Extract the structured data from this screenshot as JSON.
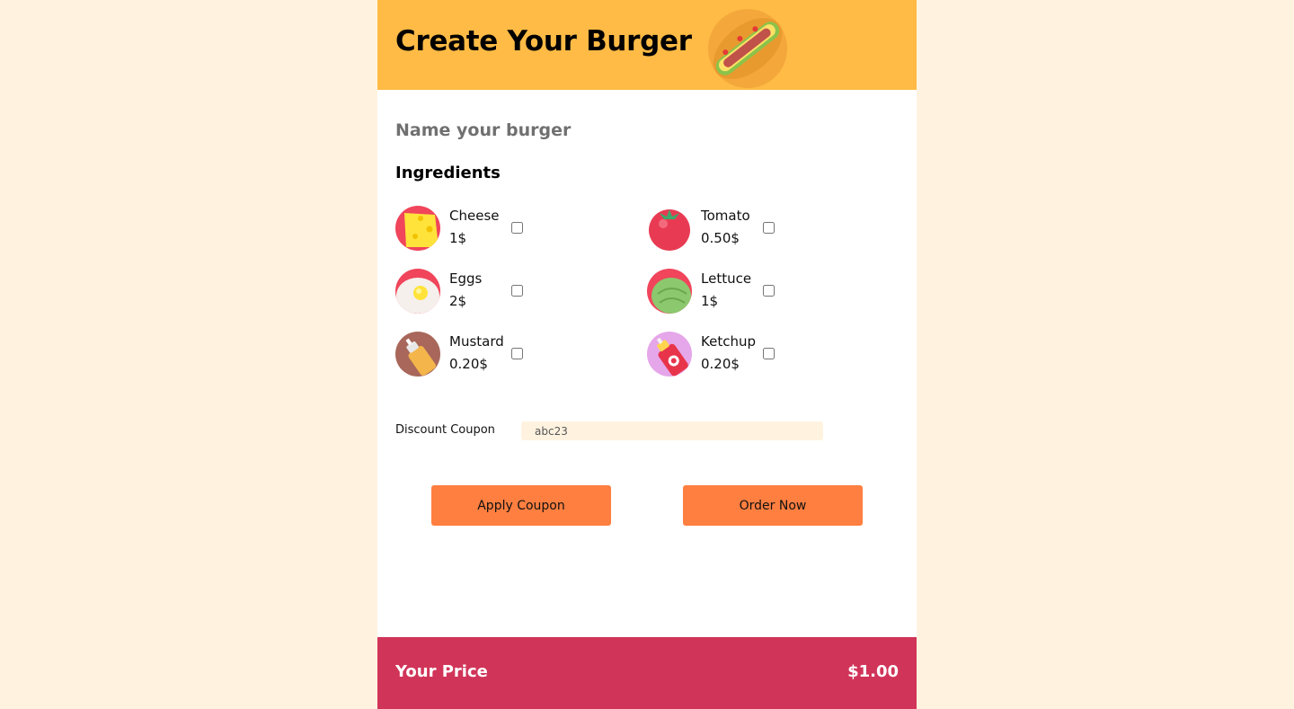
{
  "header": {
    "title": "Create Your Burger",
    "logo_icon": "burger-icon"
  },
  "name_field": {
    "placeholder": "Name your burger",
    "value": ""
  },
  "ingredients_section": {
    "title": "Ingredients"
  },
  "ingredients": [
    {
      "name": "Cheese",
      "price": "1$",
      "icon": "cheese-icon",
      "checked": false,
      "bg": "#f0455b"
    },
    {
      "name": "Tomato",
      "price": "0.50$",
      "icon": "tomato-icon",
      "checked": false,
      "bg": "#f0455b"
    },
    {
      "name": "Eggs",
      "price": "2$",
      "icon": "egg-icon",
      "checked": false,
      "bg": "#f0455b"
    },
    {
      "name": "Lettuce",
      "price": "1$",
      "icon": "lettuce-icon",
      "checked": false,
      "bg": "#f0455b"
    },
    {
      "name": "Mustard",
      "price": "0.20$",
      "icon": "mustard-icon",
      "checked": false,
      "bg": "#a8675a"
    },
    {
      "name": "Ketchup",
      "price": "0.20$",
      "icon": "ketchup-icon",
      "checked": false,
      "bg": "#e6a6ea"
    }
  ],
  "coupon": {
    "label": "Discount Coupon",
    "value": "abc23"
  },
  "buttons": {
    "apply": "Apply Coupon",
    "order": "Order Now"
  },
  "footer": {
    "label": "Your Price",
    "value": "$1.00"
  },
  "colors": {
    "page_bg": "#fff3e0",
    "header_bg": "#ffbb45",
    "button_bg": "#ff7f40",
    "footer_bg": "#d13459"
  }
}
